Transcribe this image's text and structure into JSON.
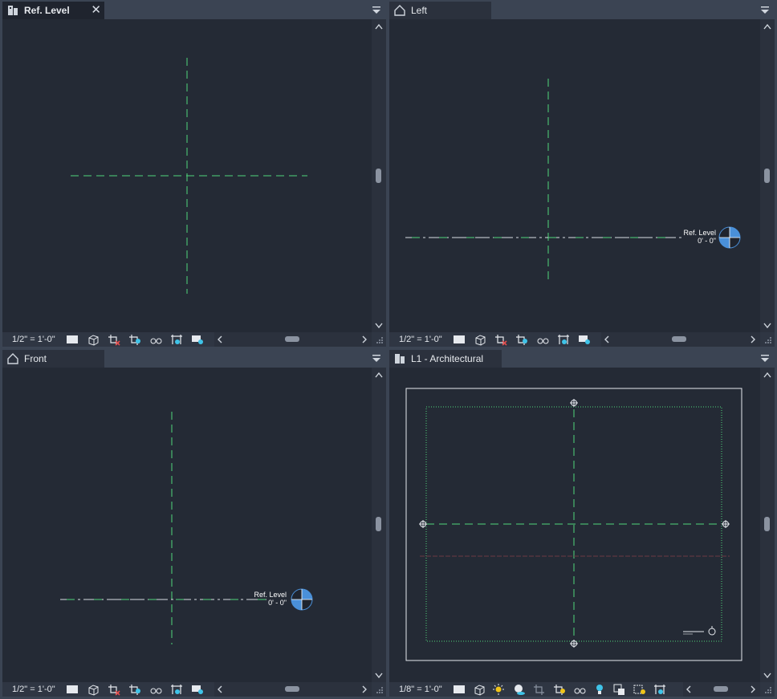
{
  "views": {
    "ref_level": {
      "title": "Ref. Level",
      "scale": "1/2\" = 1'-0\""
    },
    "left": {
      "title": "Left",
      "scale": "1/2\" = 1'-0\"",
      "level_name": "Ref. Level",
      "level_elev": "0' - 0\""
    },
    "front": {
      "title": "Front",
      "scale": "1/2\" = 1'-0\"",
      "level_name": "Ref. Level",
      "level_elev": "0' - 0\""
    },
    "l1": {
      "title": "L1 - Architectural",
      "scale": "1/8\" = 1'-0\""
    }
  },
  "icons": {
    "tab_plan": "floor-plan-icon",
    "tab_elevation": "elevation-house-icon",
    "close": "close-icon",
    "menu": "view-menu-arrow-icon"
  },
  "colors": {
    "background": "#242a35",
    "reference_plane": "#4fd57a",
    "level_head": "#4a90d9"
  }
}
